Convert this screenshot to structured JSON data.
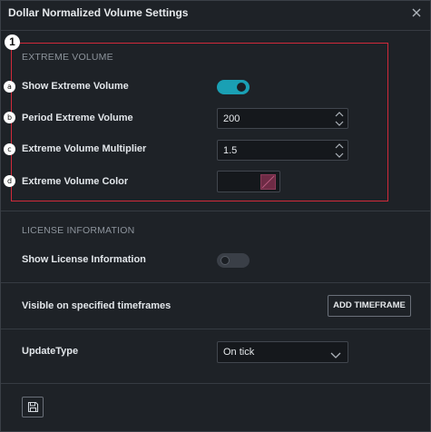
{
  "dialog": {
    "title": "Dollar Normalized Volume Settings"
  },
  "annotations": {
    "callout_number": "1",
    "markers": [
      "a",
      "b",
      "c",
      "d"
    ],
    "highlight_color": "#d12a3a"
  },
  "extreme_volume": {
    "heading": "EXTREME VOLUME",
    "show_label": "Show Extreme Volume",
    "show_enabled": true,
    "period_label": "Period Extreme Volume",
    "period_value": "200",
    "multiplier_label": "Extreme Volume Multiplier",
    "multiplier_value": "1.5",
    "color_label": "Extreme Volume Color",
    "color_value": "#6e2b45"
  },
  "license": {
    "heading": "LICENSE INFORMATION",
    "show_label": "Show License Information",
    "show_enabled": false
  },
  "timeframes": {
    "label": "Visible on specified timeframes",
    "button_label": "ADD TIMEFRAME"
  },
  "update": {
    "label": "UpdateType",
    "selected": "On tick"
  },
  "colors": {
    "accent": "#1aa0b4",
    "background": "#1e2227"
  },
  "icons": {
    "close": "close-icon",
    "save": "save-icon",
    "spinner": "spinner-arrows-icon",
    "dropdown": "chevron-down-icon"
  }
}
